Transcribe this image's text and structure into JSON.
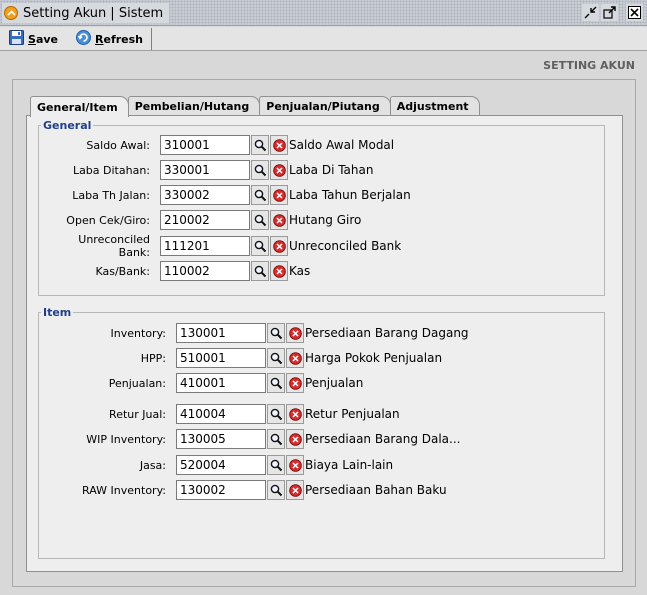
{
  "window": {
    "title": "Setting Akun | Sistem"
  },
  "toolbar": {
    "save_label_first": "S",
    "save_label_rest": "ave",
    "refresh_label_first": "R",
    "refresh_label_rest": "efresh"
  },
  "page": {
    "heading": "SETTING AKUN"
  },
  "tabs": [
    {
      "label": "General/Item"
    },
    {
      "label": "Pembelian/Hutang"
    },
    {
      "label": "Penjualan/Piutang"
    },
    {
      "label": "Adjustment"
    }
  ],
  "general": {
    "legend": "General",
    "rows": [
      {
        "label": "Saldo Awal:",
        "code": "310001",
        "desc": "Saldo Awal Modal"
      },
      {
        "label": "Laba Ditahan:",
        "code": "330001",
        "desc": "Laba Di Tahan"
      },
      {
        "label": "Laba Th Jalan:",
        "code": "330002",
        "desc": "Laba Tahun Berjalan"
      },
      {
        "label": "Open Cek/Giro:",
        "code": "210002",
        "desc": "Hutang Giro"
      },
      {
        "label": "Unreconciled Bank:",
        "code": "111201",
        "desc": "Unreconciled Bank"
      },
      {
        "label": "Kas/Bank:",
        "code": "110002",
        "desc": "Kas"
      }
    ]
  },
  "item": {
    "legend": "Item",
    "rows": [
      {
        "label": "Inventory:",
        "code": "130001",
        "desc": "Persediaan Barang Dagang"
      },
      {
        "label": "HPP:",
        "code": "510001",
        "desc": "Harga Pokok Penjualan"
      },
      {
        "label": "Penjualan:",
        "code": "410001",
        "desc": "Penjualan"
      },
      {
        "label": "Retur Jual:",
        "code": "410004",
        "desc": "Retur Penjualan"
      },
      {
        "label": "WIP Inventory:",
        "code": "130005",
        "desc": "Persediaan Barang Dala..."
      },
      {
        "label": "Jasa:",
        "code": "520004",
        "desc": "Biaya Lain-lain"
      },
      {
        "label": "RAW Inventory:",
        "code": "130002",
        "desc": "Persediaan Bahan Baku"
      }
    ]
  },
  "icons": {
    "lookup": "magnifier-icon",
    "clear": "clear-icon",
    "clear_color": "#d03030",
    "title_accent": "#f0a020"
  }
}
